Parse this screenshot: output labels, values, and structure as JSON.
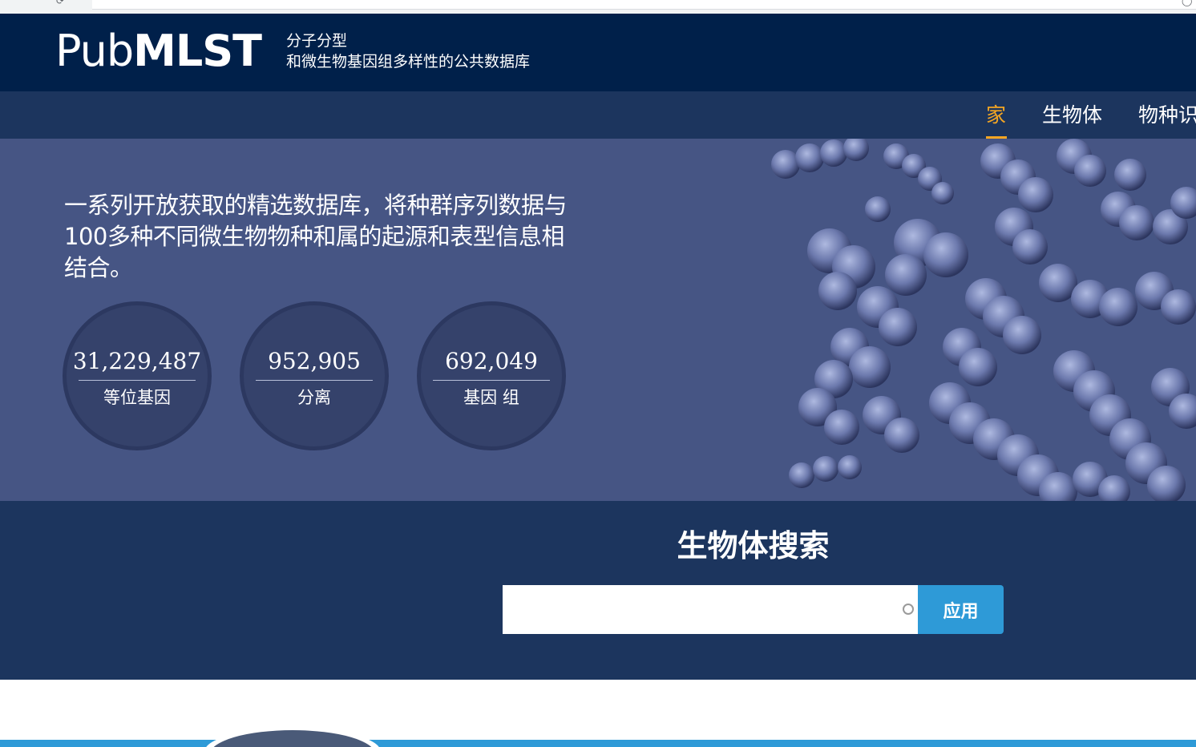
{
  "header": {
    "logo_light": "Pub",
    "logo_bold": "MLST",
    "tagline_line1": "分子分型",
    "tagline_line2": "和微生物基因组多样性的公共数据库"
  },
  "nav": {
    "items": [
      {
        "label": "家",
        "active": true
      },
      {
        "label": "生物体",
        "active": false
      },
      {
        "label": "物种识",
        "active": false
      }
    ],
    "active_color": "#f5a623"
  },
  "hero": {
    "text": "一系列开放获取的精选数据库，将种群序列数据与100多种不同微生物物种和属的起源和表型信息相结合。",
    "stats": [
      {
        "value": "31,229,487",
        "label": "等位基因"
      },
      {
        "value": "952,905",
        "label": "分离"
      },
      {
        "value": "692,049",
        "label": "基因 组"
      }
    ]
  },
  "search": {
    "title": "生物体搜索",
    "input_value": "",
    "placeholder": "",
    "button_label": "应用"
  },
  "colors": {
    "header_bg": "#00204a",
    "nav_bg": "#1c355e",
    "hero_bg": "#465584",
    "search_bg": "#1c355e",
    "button_bg": "#2e9ad7"
  }
}
